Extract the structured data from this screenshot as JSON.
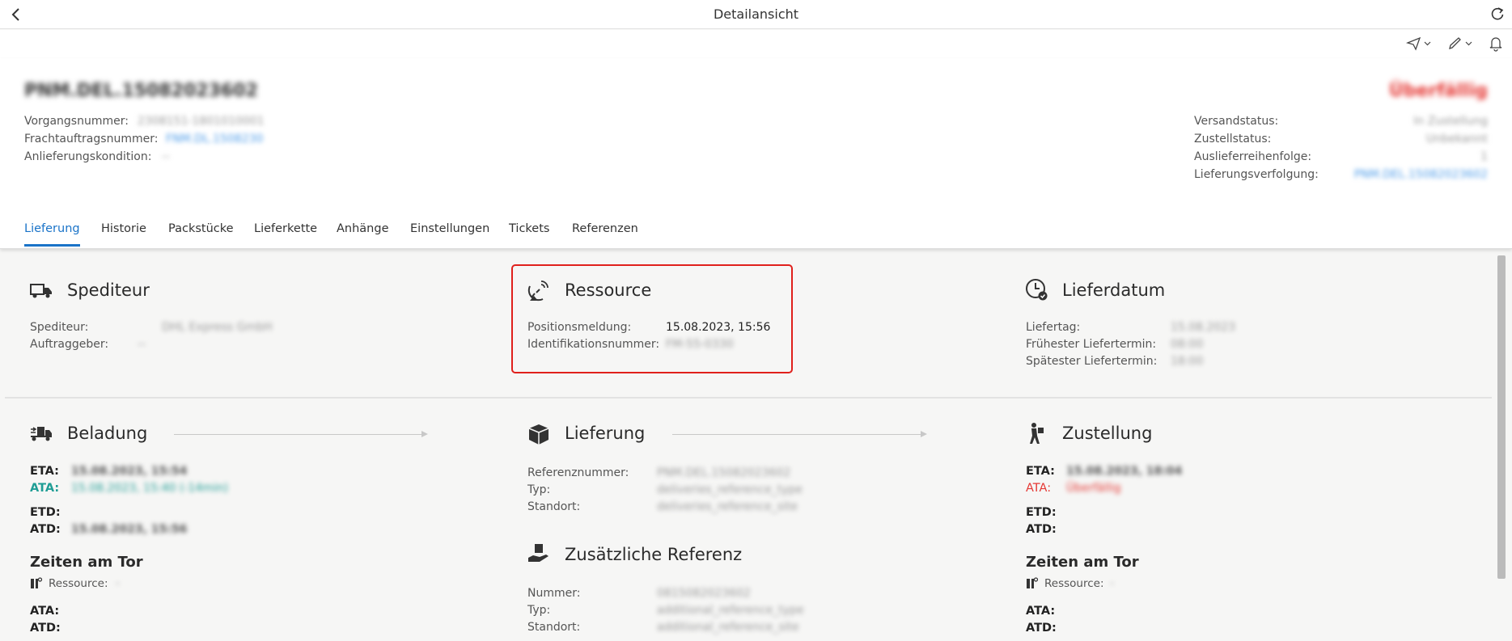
{
  "window": {
    "title": "Detailansicht"
  },
  "header": {
    "title": "PNM.DEL.15082023602",
    "status": "Überfällig",
    "left_fields": [
      {
        "label": "Vorgangsnummer:",
        "value": "2308151-1801010001"
      },
      {
        "label": "Frachtauftragsnummer:",
        "value": "FNM.DL.1508230"
      },
      {
        "label": "Anlieferungskondition:",
        "value": "--"
      }
    ],
    "right_fields": [
      {
        "label": "Versandstatus:",
        "value": "In Zustellung"
      },
      {
        "label": "Zustellstatus:",
        "value": "Unbekannt"
      },
      {
        "label": "Auslieferreihenfolge:",
        "value": "1"
      },
      {
        "label": "Lieferungsverfolgung:",
        "value": "PNM.DEL.15082023602"
      }
    ]
  },
  "tabs": [
    "Lieferung",
    "Historie",
    "Packstücke",
    "Lieferkette",
    "Anhänge",
    "Einstellungen",
    "Tickets",
    "Referenzen"
  ],
  "spediteur": {
    "title": "Spediteur",
    "rows": [
      {
        "label": "Spediteur:",
        "value": "DHL Express GmbH"
      },
      {
        "label": "Auftraggeber:",
        "value": "--"
      }
    ]
  },
  "ressource": {
    "title": "Ressource",
    "rows": [
      {
        "label": "Positionsmeldung:",
        "value": "15.08.2023, 15:56"
      },
      {
        "label": "Identifikationsnummer:",
        "value": "FM-55-0330"
      }
    ]
  },
  "lieferdatum": {
    "title": "Lieferdatum",
    "rows": [
      {
        "label": "Liefertag:",
        "value": "15.08.2023"
      },
      {
        "label": "Frühester Liefertermin:",
        "value": "08:00"
      },
      {
        "label": "Spätester Liefertermin:",
        "value": "18:00"
      }
    ]
  },
  "beladung": {
    "title": "Beladung",
    "eta_label": "ETA:",
    "eta": "15.08.2023, 15:54",
    "ata_label": "ATA:",
    "ata": "15.08.2023, 15:40 (-14min)",
    "etd_label": "ETD:",
    "atd_label": "ATD:",
    "atd": "15.08.2023, 15:56",
    "gate_title": "Zeiten am Tor",
    "resource_label": "Ressource:",
    "resource": "-",
    "gate_ata": "ATA:",
    "gate_atd": "ATD:"
  },
  "lieferung": {
    "title": "Lieferung",
    "rows": [
      {
        "label": "Referenznummer:",
        "value": "PNM.DEL.15082023602"
      },
      {
        "label": "Typ:",
        "value": "deliveries_reference_type"
      },
      {
        "label": "Standort:",
        "value": "deliveries_reference_site"
      }
    ]
  },
  "zusatz": {
    "title": "Zusätzliche Referenz",
    "rows": [
      {
        "label": "Nummer:",
        "value": "0815082023602"
      },
      {
        "label": "Typ:",
        "value": "additional_reference_type"
      },
      {
        "label": "Standort:",
        "value": "additional_reference_site"
      }
    ]
  },
  "zustellung": {
    "title": "Zustellung",
    "eta_label": "ETA:",
    "eta": "15.08.2023, 18:04",
    "ata_label": "ATA:",
    "ata": "Überfällig",
    "etd_label": "ETD:",
    "atd_label": "ATD:",
    "gate_title": "Zeiten am Tor",
    "resource_label": "Ressource:",
    "resource": "-",
    "gate_ata": "ATA:",
    "gate_atd": "ATD:"
  },
  "colors": {
    "accent": "#1a73c8",
    "alert": "#e53935",
    "teal": "#1f9d95",
    "highlight": "#e0201c"
  }
}
